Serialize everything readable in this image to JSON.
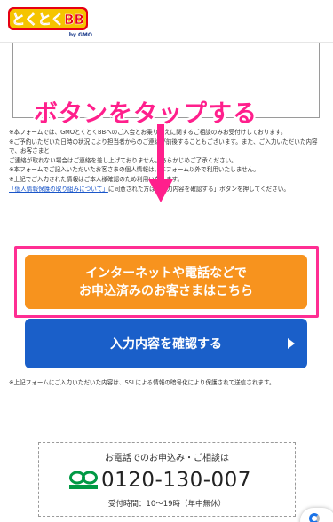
{
  "header": {
    "logo_text": "とくとくBB",
    "logo_sub": "by GMO"
  },
  "overlay": {
    "instruction": "ボタンをタップする"
  },
  "notes": {
    "line1": "※本フォームでは、GMOとくとくBBへのご入会とお乗り換えに関するご相談のみお受付けしております。",
    "line2": "※ご予約いただいた日時の状況により担当者からのご連絡が前後することもございます。また、ご入力いただいた内容で、お客さまと",
    "line3": "ご連絡が取れない場合はご連絡を差し上げておりません。あらかじめご了承ください。",
    "line4": "※本フォームでご記入いただいたお客さまの個人情報は、本フォーム以外で利用いたしません。",
    "line5": "※上記でご入力された情報はご本人様確認のため利用いたします。",
    "link": "「個人情報保護の取り組みについて」",
    "line6_suffix": "に同意された方は「入力内容を確認する」ボタンを押してください。"
  },
  "buttons": {
    "existing_line1": "インターネットや電話などで",
    "existing_line2": "お申込済みのお客さまはこちら",
    "confirm": "入力内容を確認する"
  },
  "ssl_note": "※上記フォームにご入力いただいた内容は、SSLによる情報の暗号化により保護されて送信されます。",
  "contact": {
    "title": "お電話でのお申込み・ご相談は",
    "phone": "0120-130-007",
    "hours": "受付時間：10〜19時（年中無休）"
  },
  "colors": {
    "brand_yellow": "#f5c400",
    "brand_red": "#e60012",
    "orange_button": "#f7931e",
    "blue_button": "#1a5fc9",
    "highlight_pink": "#ff2e93",
    "freedial_green": "#009944"
  }
}
